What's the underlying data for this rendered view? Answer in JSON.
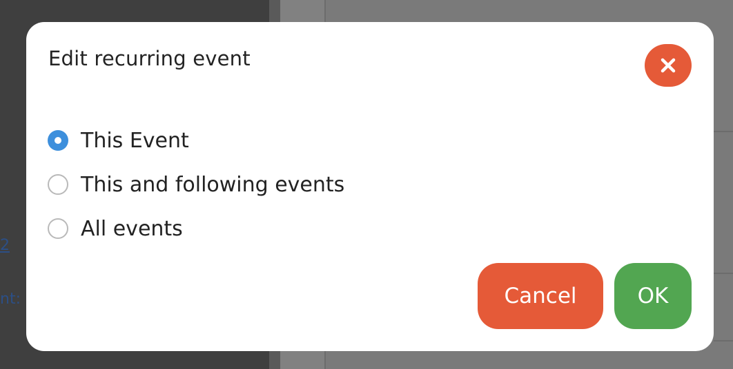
{
  "background": {
    "link_fragment": "2",
    "label_fragment": "nt:"
  },
  "dialog": {
    "title": "Edit recurring event",
    "close_icon": "close-icon",
    "options": [
      {
        "label": "This Event",
        "checked": true
      },
      {
        "label": "This and following events",
        "checked": false
      },
      {
        "label": "All events",
        "checked": false
      }
    ],
    "cancel_label": "Cancel",
    "ok_label": "OK"
  },
  "colors": {
    "danger": "#e55a38",
    "success": "#52a651",
    "radio_selected": "#3d8fdc"
  }
}
